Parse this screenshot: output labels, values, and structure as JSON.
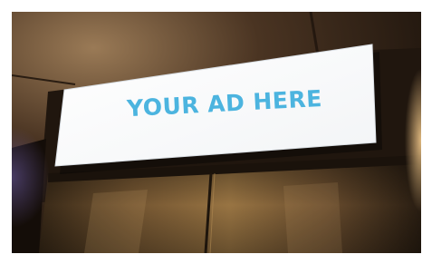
{
  "scene": {
    "description_kind": "photo",
    "billboard": {
      "text": "YOUR AD HERE",
      "text_color": "#4cb4df",
      "panel_color": "#ffffff"
    },
    "colors": {
      "ceiling": "#3a2a1c",
      "wall_dark": "#1c140d",
      "elevator_door": "#8a6a3e",
      "warm_light": "#f3c98a"
    }
  }
}
